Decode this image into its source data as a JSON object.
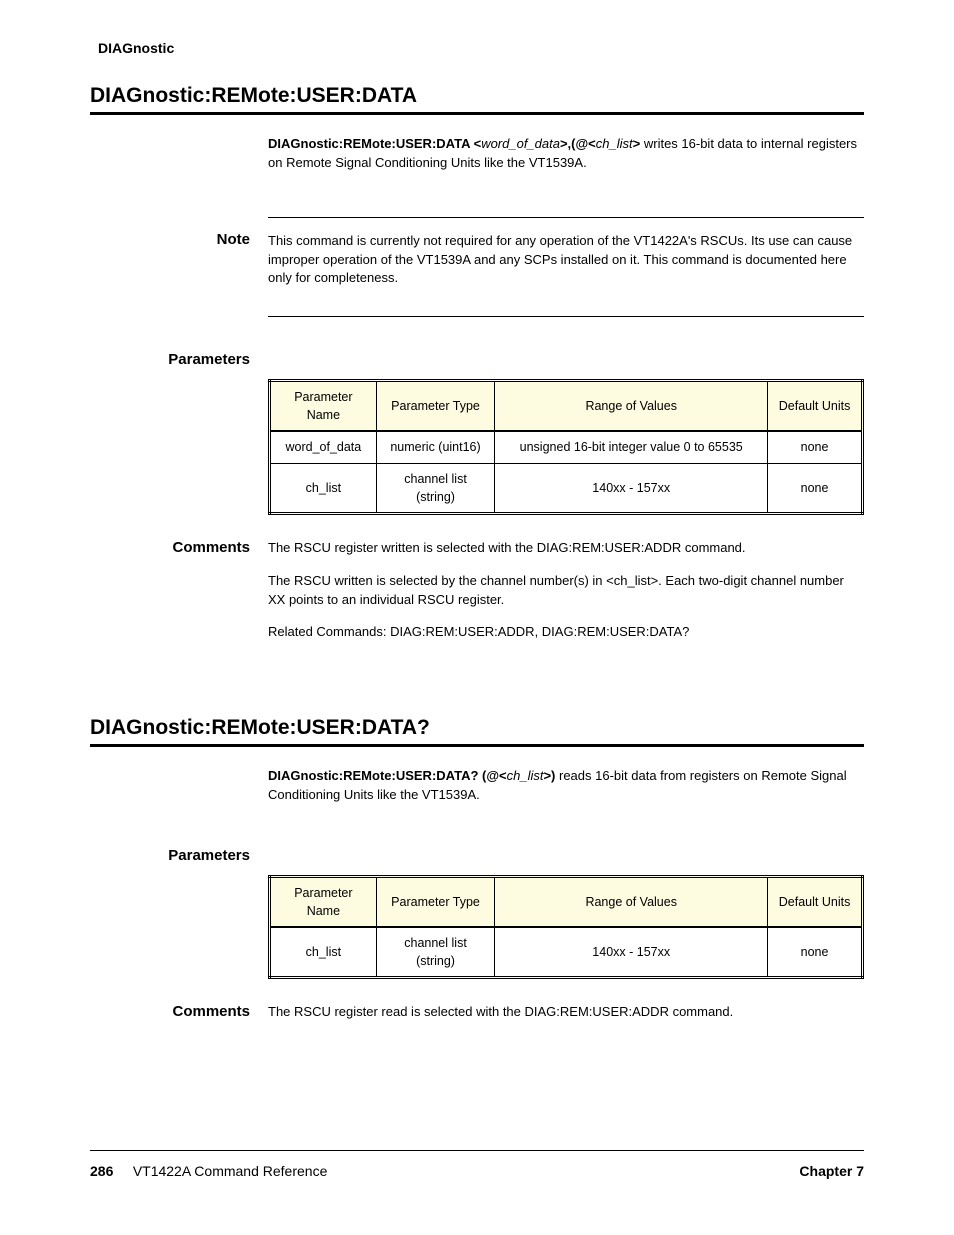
{
  "runningHeader": "DIAGnostic",
  "section1": {
    "title": "DIAGnostic:REMote:USER:DATA",
    "syntax": {
      "b1": "DIAGnostic:REMote:USER:DATA  <",
      "i1": "word_of_data",
      "b2": ">,(@<",
      "i2": "ch_list",
      "b3": ">",
      "tail": " writes 16-bit data to internal registers on Remote Signal Conditioning Units like the VT1539A."
    },
    "noteLabel": "Note",
    "noteText": "This command is currently not required for any operation of the VT1422A's RSCUs. Its use can cause improper operation of the VT1539A and any SCPs installed on it. This command is documented here only for completeness.",
    "paramsLabel": "Parameters",
    "params": {
      "headers": [
        "Parameter Name",
        "Parameter Type",
        "Range of Values",
        "Default Units"
      ],
      "rows": [
        [
          "word_of_data",
          "numeric (uint16)",
          "unsigned 16-bit integer value 0 to 65535",
          "none"
        ],
        [
          "ch_list",
          "channel list (string)",
          "140xx - 157xx",
          "none"
        ]
      ]
    },
    "commentsLabel": "Comments",
    "comments": [
      "The RSCU register written is selected with the DIAG:REM:USER:ADDR command.",
      "The RSCU written is selected by the channel number(s) in <ch_list>. Each two-digit channel number XX points to an individual RSCU register.",
      "Related Commands: DIAG:REM:USER:ADDR, DIAG:REM:USER:DATA?"
    ]
  },
  "section2": {
    "title": "DIAGnostic:REMote:USER:DATA?",
    "syntax": {
      "b1": "DIAGnostic:REMote:USER:DATA?  (@<",
      "i1": "ch_list",
      "b2": ">)",
      "tail": " reads 16-bit data from registers on Remote Signal Conditioning Units like the VT1539A."
    },
    "paramsLabel": "Parameters",
    "params": {
      "headers": [
        "Parameter Name",
        "Parameter Type",
        "Range of Values",
        "Default Units"
      ],
      "rows": [
        [
          "ch_list",
          "channel list (string)",
          "140xx - 157xx",
          "none"
        ]
      ]
    },
    "commentsLabel": "Comments",
    "comments": [
      "The RSCU register read is selected with the DIAG:REM:USER:ADDR command."
    ]
  },
  "footer": {
    "pageNum": "286",
    "leftText": "VT1422A Command Reference",
    "rightText": "Chapter 7"
  }
}
